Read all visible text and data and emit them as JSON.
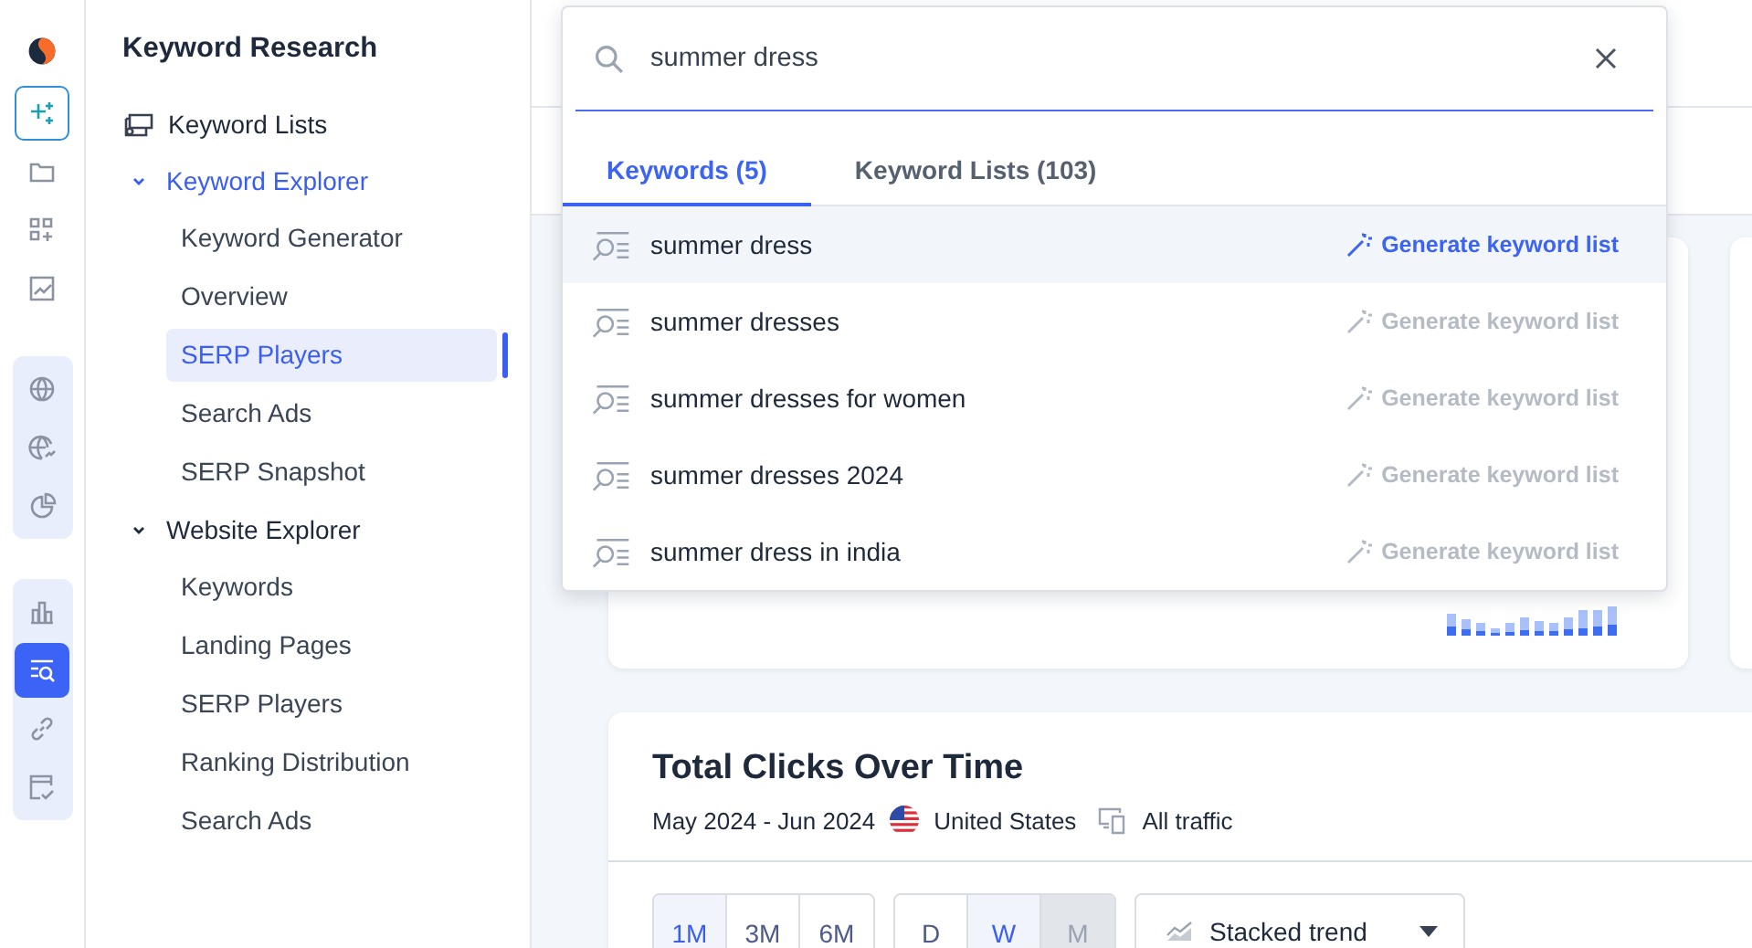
{
  "rail": {
    "groups": [
      {
        "items": [
          {
            "selected": true
          },
          {
            "selected": false
          },
          {
            "selected": false
          },
          {
            "selected": false
          }
        ]
      },
      {
        "items": [
          {
            "selected": false
          },
          {
            "selected": false
          },
          {
            "selected": false
          }
        ]
      },
      {
        "items": [
          {
            "selected": false
          },
          {
            "selected": true
          },
          {
            "selected": false
          },
          {
            "selected": false
          }
        ]
      }
    ]
  },
  "nav": {
    "title": "Keyword Research",
    "items": [
      {
        "label": "Keyword Lists",
        "kind": "link",
        "selected": false
      },
      {
        "label": "Keyword Explorer",
        "kind": "section",
        "expanded": true,
        "selected": true,
        "children": [
          {
            "label": "Keyword Generator",
            "selected": false
          },
          {
            "label": "Overview",
            "selected": false
          },
          {
            "label": "SERP Players",
            "selected": true
          },
          {
            "label": "Search Ads",
            "selected": false
          },
          {
            "label": "SERP Snapshot",
            "selected": false
          }
        ]
      },
      {
        "label": "Website Explorer",
        "kind": "section",
        "expanded": true,
        "selected": false,
        "children": [
          {
            "label": "Keywords",
            "selected": false
          },
          {
            "label": "Landing Pages",
            "selected": false
          },
          {
            "label": "SERP Players",
            "selected": false
          },
          {
            "label": "Ranking Distribution",
            "selected": false
          },
          {
            "label": "Search Ads",
            "selected": false
          }
        ]
      }
    ]
  },
  "search": {
    "value": "summer dress",
    "tabs": [
      {
        "label": "Keywords (5)",
        "selected": true
      },
      {
        "label": "Keyword Lists (103)",
        "selected": false
      }
    ],
    "results": [
      {
        "text": "summer dress",
        "action": "Generate keyword list",
        "selected": true
      },
      {
        "text": "summer dresses",
        "action": "Generate keyword list",
        "selected": false
      },
      {
        "text": "summer dresses for women",
        "action": "Generate keyword list",
        "selected": false
      },
      {
        "text": "summer dresses 2024",
        "action": "Generate keyword list",
        "selected": false
      },
      {
        "text": "summer dress in india",
        "action": "Generate keyword list",
        "selected": false
      }
    ]
  },
  "clicks_card": {
    "title": "Total Clicks Over Time",
    "period": "May 2024 - Jun 2024",
    "country": "United States",
    "traffic": "All traffic",
    "ranges": [
      {
        "label": "1M",
        "selected": true
      },
      {
        "label": "3M",
        "selected": false
      },
      {
        "label": "6M",
        "selected": false
      }
    ],
    "intervals": [
      {
        "label": "D",
        "selected": false,
        "disabled": false
      },
      {
        "label": "W",
        "selected": true,
        "disabled": false
      },
      {
        "label": "M",
        "selected": false,
        "disabled": true
      }
    ],
    "view": "Stacked trend"
  }
}
